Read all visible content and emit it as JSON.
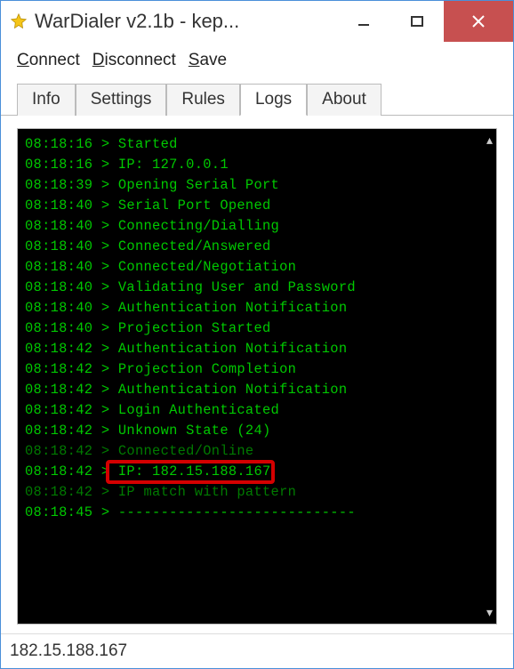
{
  "window": {
    "title": "WarDialer v2.1b - kep..."
  },
  "menu": {
    "connect": "Connect",
    "disconnect": "Disconnect",
    "save": "Save"
  },
  "tabs": {
    "info": "Info",
    "settings": "Settings",
    "rules": "Rules",
    "logs": "Logs",
    "about": "About",
    "active": "logs"
  },
  "logs": [
    {
      "time": "08:18:16",
      "msg": "Started"
    },
    {
      "time": "08:18:16",
      "msg": "IP: 127.0.0.1"
    },
    {
      "time": "08:18:39",
      "msg": "Opening Serial Port"
    },
    {
      "time": "08:18:40",
      "msg": "Serial Port Opened"
    },
    {
      "time": "08:18:40",
      "msg": "Connecting/Dialling"
    },
    {
      "time": "08:18:40",
      "msg": "Connected/Answered"
    },
    {
      "time": "08:18:40",
      "msg": "Connected/Negotiation"
    },
    {
      "time": "08:18:40",
      "msg": "Validating User and Password"
    },
    {
      "time": "08:18:40",
      "msg": "Authentication Notification"
    },
    {
      "time": "08:18:40",
      "msg": "Projection Started"
    },
    {
      "time": "08:18:42",
      "msg": "Authentication Notification"
    },
    {
      "time": "08:18:42",
      "msg": "Projection Completion"
    },
    {
      "time": "08:18:42",
      "msg": "Authentication Notification"
    },
    {
      "time": "08:18:42",
      "msg": "Login Authenticated"
    },
    {
      "time": "08:18:42",
      "msg": "Unknown State (24)"
    },
    {
      "time": "08:18:42",
      "msg": "Connected/Online",
      "dim": true
    },
    {
      "time": "08:18:42",
      "msg": "IP: 182.15.188.167",
      "highlight": true
    },
    {
      "time": "08:18:42",
      "msg": "IP match with pattern",
      "dim": true
    },
    {
      "time": "08:18:45",
      "msg": "----------------------------"
    }
  ],
  "status": {
    "text": "182.15.188.167"
  },
  "colors": {
    "terminal_fg": "#00c800",
    "terminal_bg": "#000000",
    "close_btn": "#c75050",
    "highlight_border": "#d40000"
  }
}
